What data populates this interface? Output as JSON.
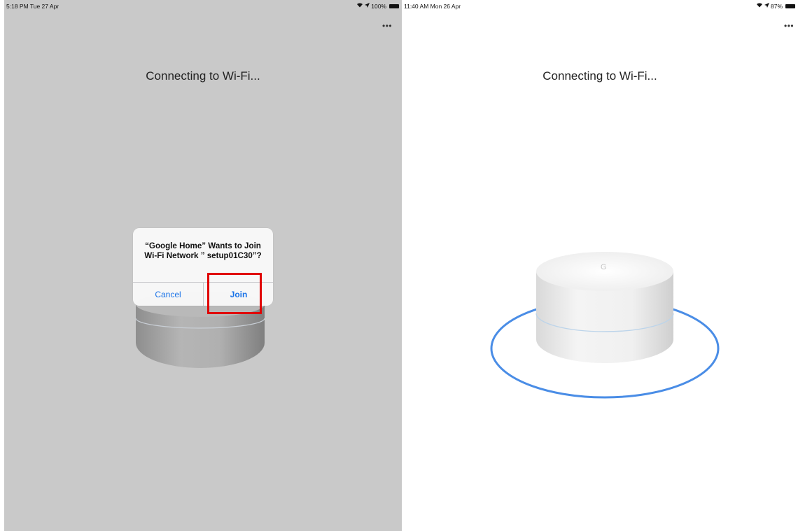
{
  "left_screen": {
    "status": {
      "time": "5:18 PM  Tue 27 Apr",
      "battery": "100%"
    },
    "more_menu": "•••",
    "heading": "Connecting to Wi-Fi...",
    "alert": {
      "title": "“Google Home” Wants to Join Wi-Fi Network ” setup01C30”?",
      "cancel_label": "Cancel",
      "join_label": "Join"
    }
  },
  "right_screen": {
    "status": {
      "time": "11:40 AM  Mon 26 Apr",
      "battery": "87%"
    },
    "more_menu": "•••",
    "heading": "Connecting to Wi-Fi...",
    "device_logo": "G"
  },
  "icons": [
    "wifi-icon",
    "location-arrow-icon",
    "battery-icon",
    "more-icon"
  ],
  "colors": {
    "accent": "#1a73e8",
    "highlight": "#e00000",
    "ring": "#4a8de6",
    "dim_background": "#c9c9c9"
  }
}
